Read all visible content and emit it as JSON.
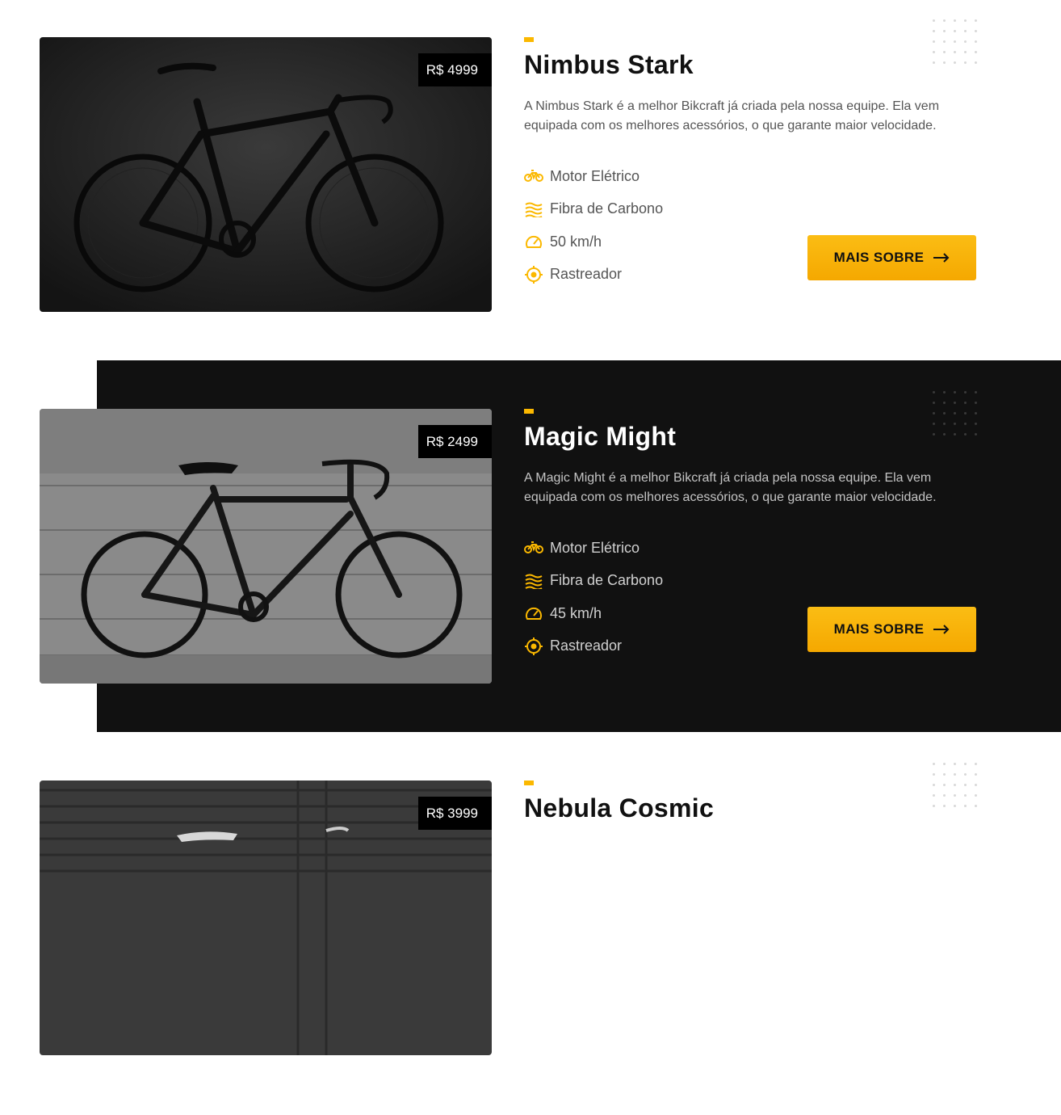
{
  "colors": {
    "accent": "#fbb800",
    "dark_section": "#111111"
  },
  "products": [
    {
      "name": "Nimbus Stark",
      "price": "R$ 4999",
      "description": "A Nimbus Stark é a melhor Bikcraft já criada pela nossa equipe. Ela vem equipada com os melhores acessórios, o que garante maior velocidade.",
      "features": [
        {
          "icon": "electric-bike-icon",
          "label": "Motor Elétrico"
        },
        {
          "icon": "carbon-fiber-icon",
          "label": "Fibra de Carbono"
        },
        {
          "icon": "speedometer-icon",
          "label": "50 km/h"
        },
        {
          "icon": "tracker-icon",
          "label": "Rastreador"
        }
      ],
      "button_label": "MAIS SOBRE"
    },
    {
      "name": "Magic Might",
      "price": "R$ 2499",
      "description": "A Magic Might é a melhor Bikcraft já criada pela nossa equipe. Ela vem equipada com os melhores acessórios, o que garante maior velocidade.",
      "features": [
        {
          "icon": "electric-bike-icon",
          "label": "Motor Elétrico"
        },
        {
          "icon": "carbon-fiber-icon",
          "label": "Fibra de Carbono"
        },
        {
          "icon": "speedometer-icon",
          "label": "45 km/h"
        },
        {
          "icon": "tracker-icon",
          "label": "Rastreador"
        }
      ],
      "button_label": "MAIS SOBRE"
    },
    {
      "name": "Nebula Cosmic",
      "price": "R$ 3999"
    }
  ]
}
